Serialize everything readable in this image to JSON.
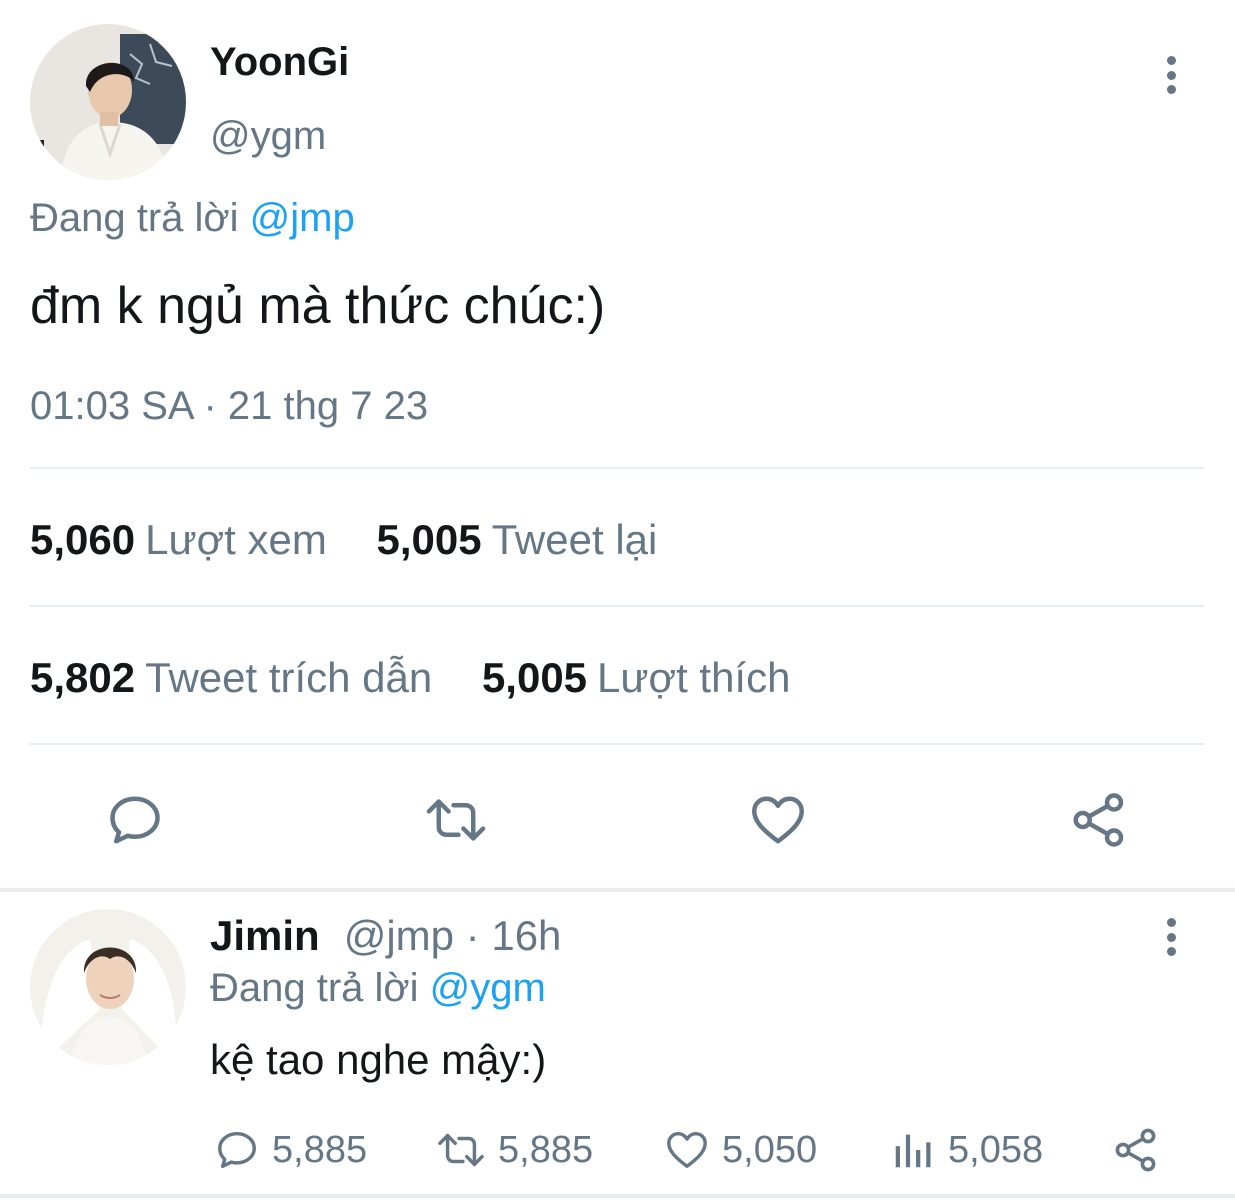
{
  "main_tweet": {
    "display_name": "YoonGi",
    "handle": "@ygm",
    "replying_prefix": "Đang trả lời",
    "replying_to": "@jmp",
    "text": "đm k ngủ mà thức chúc:)",
    "timestamp": "01:03 SA · 21 thg 7 23",
    "stats": {
      "views": {
        "count": "5,060",
        "label": "Lượt xem"
      },
      "retweets": {
        "count": "5,005",
        "label": "Tweet lại"
      },
      "quotes": {
        "count": "5,802",
        "label": "Tweet trích dẫn"
      },
      "likes": {
        "count": "5,005",
        "label": "Lượt thích"
      }
    },
    "actions": [
      "reply-icon",
      "retweet-icon",
      "like-icon",
      "share-icon"
    ]
  },
  "reply_tweet": {
    "display_name": "Jimin",
    "handle_time": "@jmp · 16h",
    "replying_prefix": "Đang trả lời",
    "replying_to": "@ygm",
    "text": "kệ tao nghe mậy:)",
    "counts": {
      "replies": "5,885",
      "retweets": "5,885",
      "likes": "5,050",
      "views": "5,058"
    }
  },
  "colors": {
    "text_primary": "#14171a",
    "text_secondary": "#657786",
    "link": "#1da1f2",
    "divider": "#e6ecf0"
  }
}
